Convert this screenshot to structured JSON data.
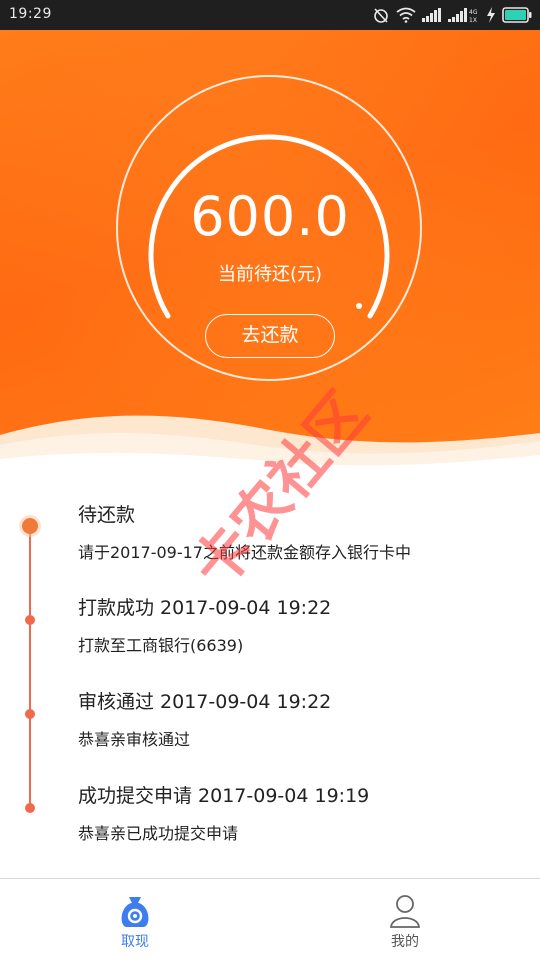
{
  "status_bar": {
    "time": "19:29",
    "icons": [
      "alarm-off-icon",
      "wifi-icon",
      "signal-icon",
      "signal-4g-icon",
      "charging-icon",
      "battery-icon"
    ],
    "network_labels": [
      "4G",
      "1X"
    ]
  },
  "hero": {
    "amount": "600.0",
    "amount_label": "当前待还(元)",
    "repay_button": "去还款"
  },
  "timeline": [
    {
      "title": "待还款",
      "desc": "请于2017-09-17之前将还款金额存入银行卡中",
      "state": "current"
    },
    {
      "title": "打款成功 2017-09-04 19:22",
      "desc": "打款至工商银行(6639)",
      "state": "done"
    },
    {
      "title": "审核通过 2017-09-04 19:22",
      "desc": "恭喜亲审核通过",
      "state": "done"
    },
    {
      "title": "成功提交申请 2017-09-04 19:19",
      "desc": "恭喜亲已成功提交申请",
      "state": "done"
    }
  ],
  "watermark": {
    "text": "卡农社区"
  },
  "tabbar": {
    "tabs": [
      {
        "label": "取现",
        "icon": "money-bag-icon",
        "active": true
      },
      {
        "label": "我的",
        "icon": "user-icon",
        "active": false
      }
    ]
  },
  "colors": {
    "accent_orange": "#ff7c1a",
    "timeline_red": "#ef6a4a",
    "tab_active_blue": "#3d7df0"
  }
}
